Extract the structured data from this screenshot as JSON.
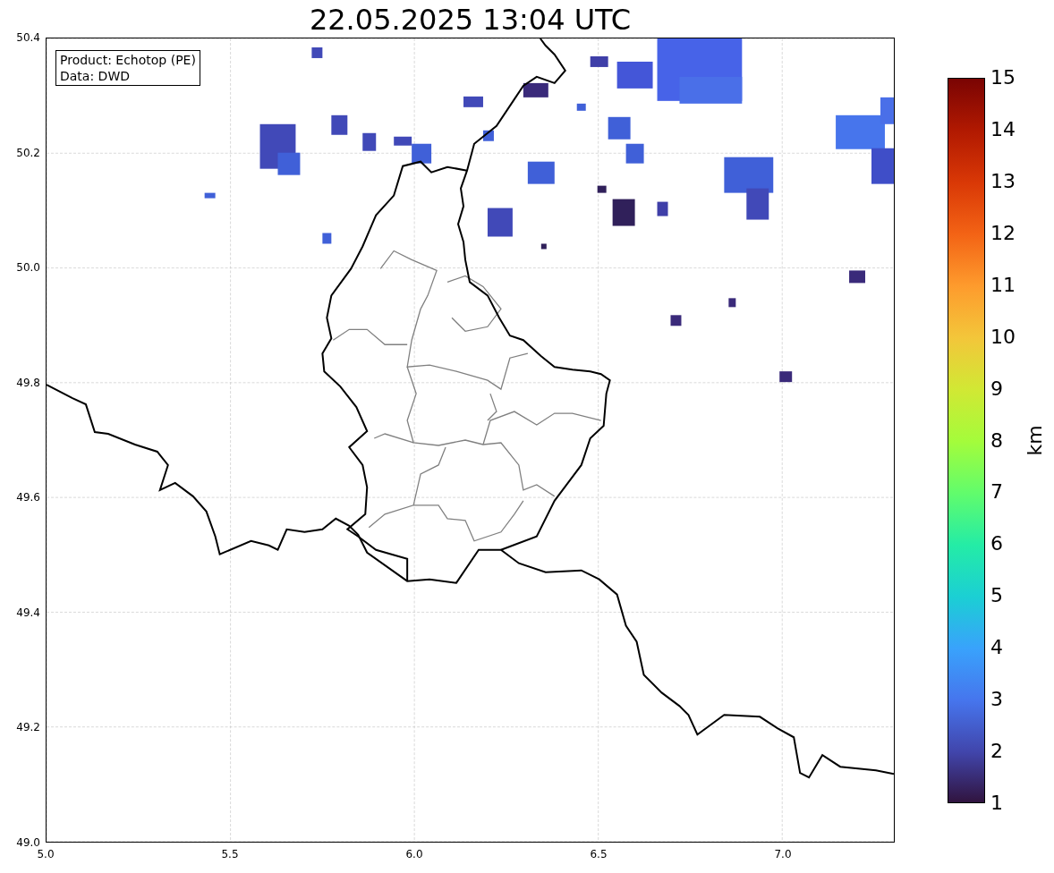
{
  "title": "22.05.2025 13:04 UTC",
  "legend": [
    "Product: Echotop (PE)",
    "Data: DWD"
  ],
  "x_ticks": [
    "5.0",
    "5.5",
    "6.0",
    "6.5",
    "7.0"
  ],
  "y_ticks": [
    "50.4",
    "50.2",
    "50.0",
    "49.8",
    "49.6",
    "49.4",
    "49.2",
    "49.0"
  ],
  "colorbar": {
    "ticks": [
      "15",
      "14",
      "13",
      "12",
      "11",
      "10",
      "9",
      "8",
      "7",
      "6",
      "5",
      "4",
      "3",
      "2",
      "1"
    ],
    "label": "km"
  }
}
